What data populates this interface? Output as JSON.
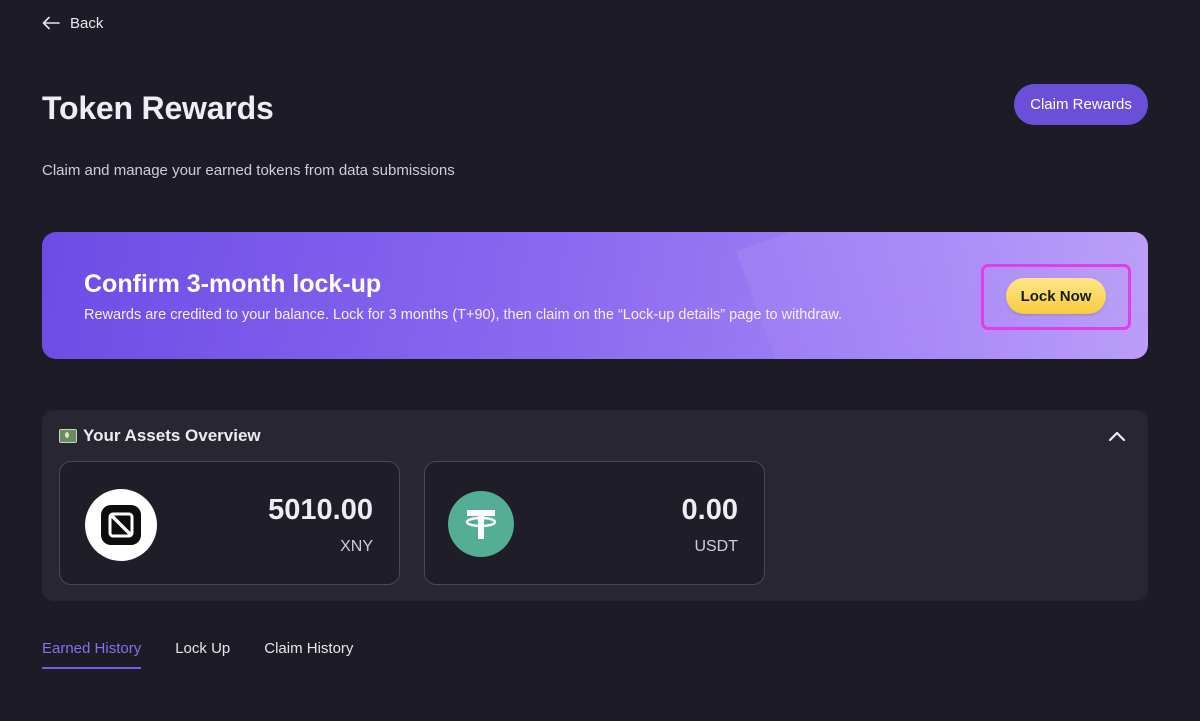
{
  "nav": {
    "back_label": "Back"
  },
  "header": {
    "title": "Token Rewards",
    "subtitle": "Claim and manage your earned tokens from data submissions",
    "claim_button": "Claim Rewards"
  },
  "banner": {
    "title": "Confirm 3-month lock-up",
    "description": "Rewards are credited to your balance. Lock for 3 months (T+90), then claim on the “Lock-up details” page to withdraw.",
    "lock_button": "Lock Now"
  },
  "assets": {
    "title": "Your Assets Overview",
    "header_icon": "money-emoji-icon",
    "collapse_icon": "chevron-up-icon",
    "items": [
      {
        "amount": "5010.00",
        "symbol": "XNY",
        "icon": "xny-logo-icon"
      },
      {
        "amount": "0.00",
        "symbol": "USDT",
        "icon": "tether-logo-icon"
      }
    ]
  },
  "tabs": [
    {
      "label": "Earned History",
      "active": true
    },
    {
      "label": "Lock Up",
      "active": false
    },
    {
      "label": "Claim History",
      "active": false
    }
  ],
  "colors": {
    "background": "#1d1c26",
    "accent": "#6b4fd8",
    "highlight": "#e23ee8",
    "lock_button": "#f6cc3c",
    "tether": "#53ae94"
  }
}
